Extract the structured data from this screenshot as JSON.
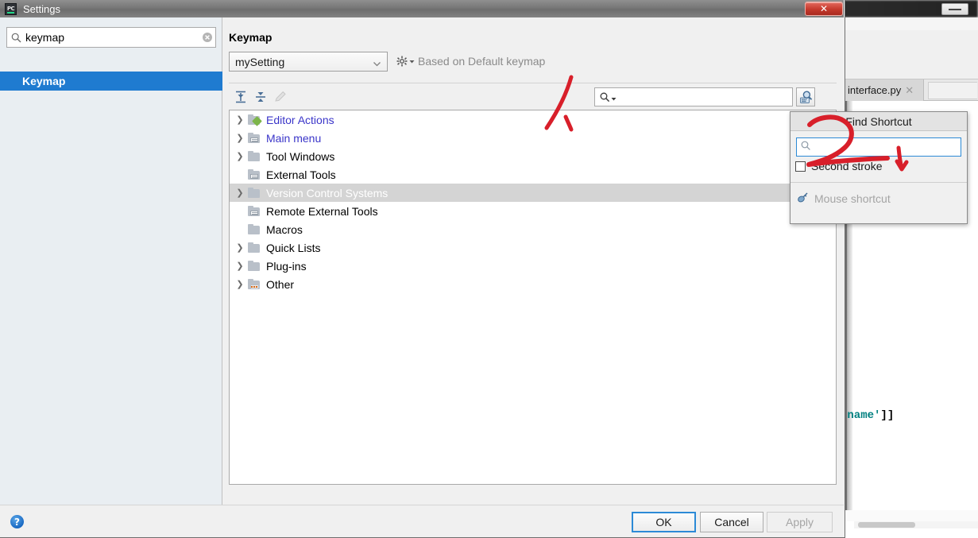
{
  "background_window": {
    "tab": {
      "label": "interface.py",
      "close_icon": "close-icon"
    },
    "code_snippet": {
      "string": "'name'",
      "brackets": "]]"
    },
    "minimize_icon": "minimize-icon"
  },
  "dialog": {
    "title": "Settings",
    "app_icon": "pycharm-icon",
    "close_label": "✕",
    "left_pane": {
      "search": {
        "value": "keymap",
        "placeholder": "",
        "search_icon": "search-icon",
        "clear_icon": "clear-icon"
      },
      "selected_item": "Keymap"
    },
    "right_pane": {
      "title": "Keymap",
      "keymap_combo": {
        "value": "mySetting",
        "arrow_icon": "chevron-down-icon"
      },
      "gear_icon": "gear-icon",
      "based_on": "Based on Default keymap",
      "toolbar": {
        "expand_all_icon": "expand-all-icon",
        "collapse_all_icon": "collapse-all-icon",
        "edit_icon": "pencil-edit-icon",
        "search": {
          "value": "",
          "placeholder": "",
          "icon": "search-dropdown-icon"
        },
        "find_by_shortcut_icon": "find-by-shortcut-icon"
      },
      "tree": [
        {
          "label": "Editor Actions",
          "icon": "folder-pencil-icon",
          "expandable": true,
          "link": true,
          "selected": false
        },
        {
          "label": "Main menu",
          "icon": "folder-menu-icon",
          "expandable": true,
          "link": true,
          "selected": false
        },
        {
          "label": "Tool Windows",
          "icon": "folder-icon",
          "expandable": true,
          "link": false,
          "selected": false
        },
        {
          "label": "External Tools",
          "icon": "folder-tools-icon",
          "expandable": false,
          "link": false,
          "selected": false
        },
        {
          "label": "Version Control Systems",
          "icon": "folder-icon",
          "expandable": true,
          "link": false,
          "selected": true
        },
        {
          "label": "Remote External Tools",
          "icon": "folder-tools-icon",
          "expandable": false,
          "link": false,
          "selected": false
        },
        {
          "label": "Macros",
          "icon": "folder-icon",
          "expandable": false,
          "link": false,
          "selected": false
        },
        {
          "label": "Quick Lists",
          "icon": "folder-icon",
          "expandable": true,
          "link": false,
          "selected": false
        },
        {
          "label": "Plug-ins",
          "icon": "folder-icon",
          "expandable": true,
          "link": false,
          "selected": false
        },
        {
          "label": "Other",
          "icon": "folder-dots-icon",
          "expandable": true,
          "link": false,
          "selected": false
        }
      ]
    },
    "bottom": {
      "help_icon": "help-icon",
      "help_label": "?",
      "ok_label": "OK",
      "cancel_label": "Cancel",
      "apply_label": "Apply"
    }
  },
  "find_shortcut_popup": {
    "title": "Find Shortcut",
    "search": {
      "value": "",
      "placeholder": "",
      "icon": "search-icon"
    },
    "second_stroke_label": "Second stroke",
    "second_stroke_checked": false,
    "mouse_shortcut_label": "Mouse shortcut",
    "mouse_icon": "mouse-icon"
  },
  "annotations": {
    "accent_color": "#d81f2a",
    "marks": [
      {
        "name": "arrow-to-find-shortcut-button",
        "kind": "arrow-stroke"
      },
      {
        "name": "handwritten-number-2",
        "kind": "digit"
      },
      {
        "name": "arrow-to-second-stroke",
        "kind": "arrow-stroke"
      }
    ]
  },
  "colors": {
    "selection_blue": "#1f7bd0",
    "link_blue": "#3a35c9",
    "tree_selected_gray": "#d4d4d4",
    "focus_blue": "#2c8ad6",
    "close_red": "#c5392c"
  }
}
